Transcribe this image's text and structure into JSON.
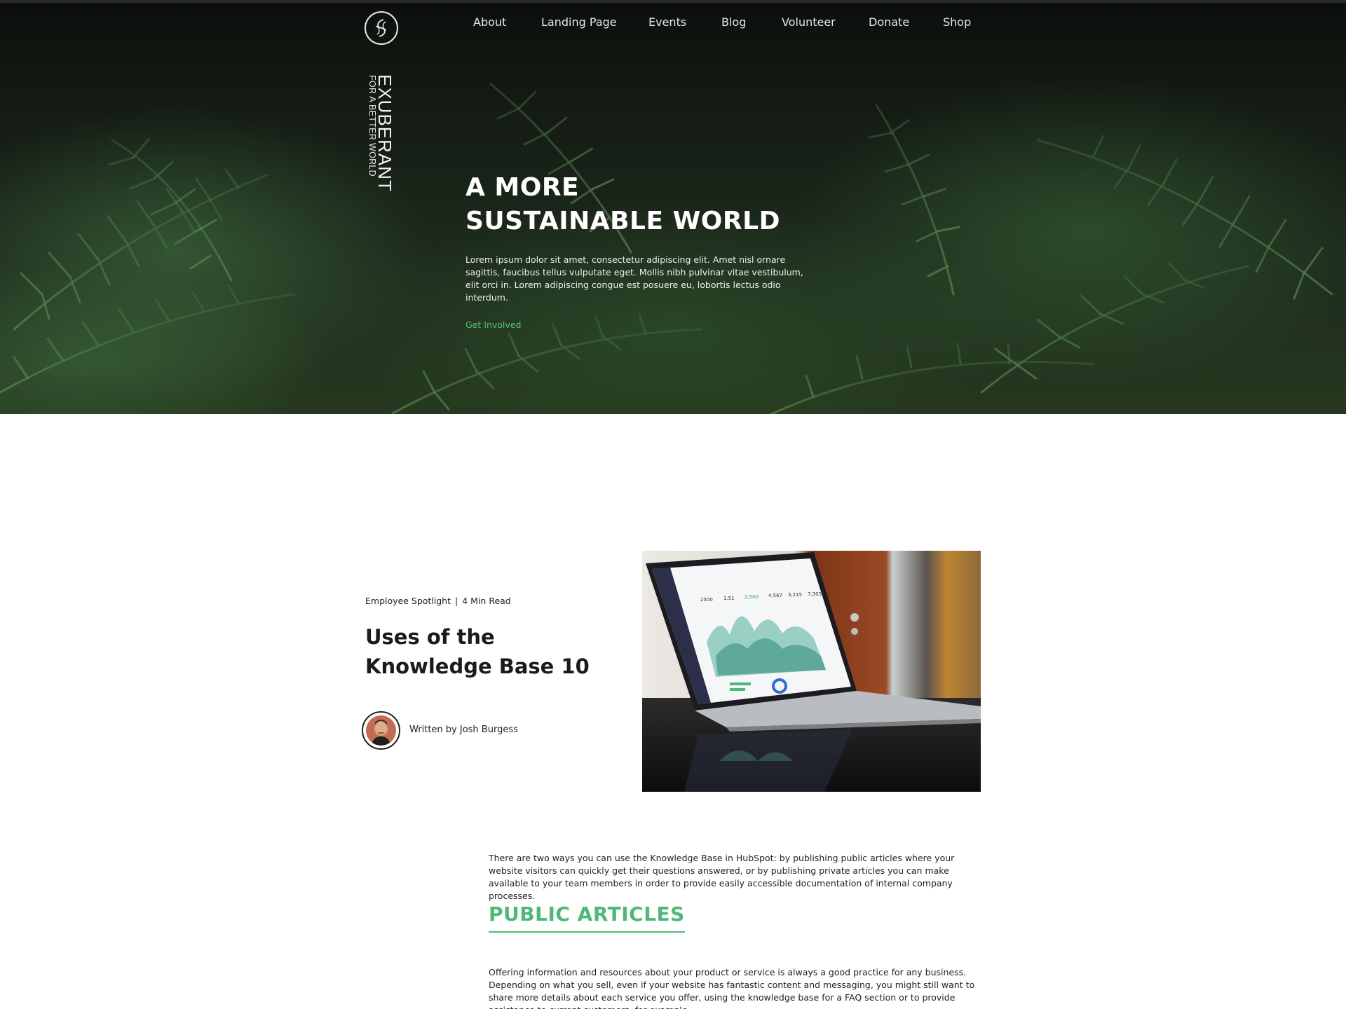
{
  "nav": {
    "items": [
      "About",
      "Landing Page",
      "Events",
      "Blog",
      "Volunteer",
      "Donate",
      "Shop"
    ]
  },
  "brand": {
    "name": "EXUBERANT",
    "tagline": "FOR A BETTER WORLD",
    "logo_icon": "leaf-swirl-icon"
  },
  "hero": {
    "title_line1": "A MORE",
    "title_line2": "SUSTAINABLE WORLD",
    "body": "Lorem ipsum dolor sit amet, consectetur adipiscing elit. Amet nisl ornare sagittis, faucibus tellus vulputate eget. Mollis nibh pulvinar vitae vestibulum, elit orci in. Lorem adipiscing congue est posuere eu, lobortis lectus odio interdum.",
    "cta": "Get Involved"
  },
  "article": {
    "category": "Employee Spotlight",
    "separator": "|",
    "read_time": "4 Min Read",
    "title": "Uses of the Knowledge Base 10",
    "author_line": "Written by Josh Burgess",
    "image_screen_stats": [
      "2500",
      "1.51",
      "2,500",
      "4,567",
      "3,215",
      "7,305"
    ],
    "intro": "There are two ways you can use the Knowledge Base in HubSpot: by publishing public articles where your website visitors can quickly get their questions answered, or by publishing private articles you can make available to your team members in order to provide easily accessible documentation of internal company processes.",
    "section_heading": "PUBLIC ARTICLES",
    "section_body": "Offering information and resources about your product or service is always a good practice for any business. Depending on what you sell, even if your website has fantastic content and messaging, you might still want to share more details about each service you offer, using the knowledge base for a FAQ section or to provide assistance to current customers, for example."
  },
  "colors": {
    "accent": "#4fb879",
    "hero_text": "#ffffff",
    "body_text": "#222222"
  }
}
